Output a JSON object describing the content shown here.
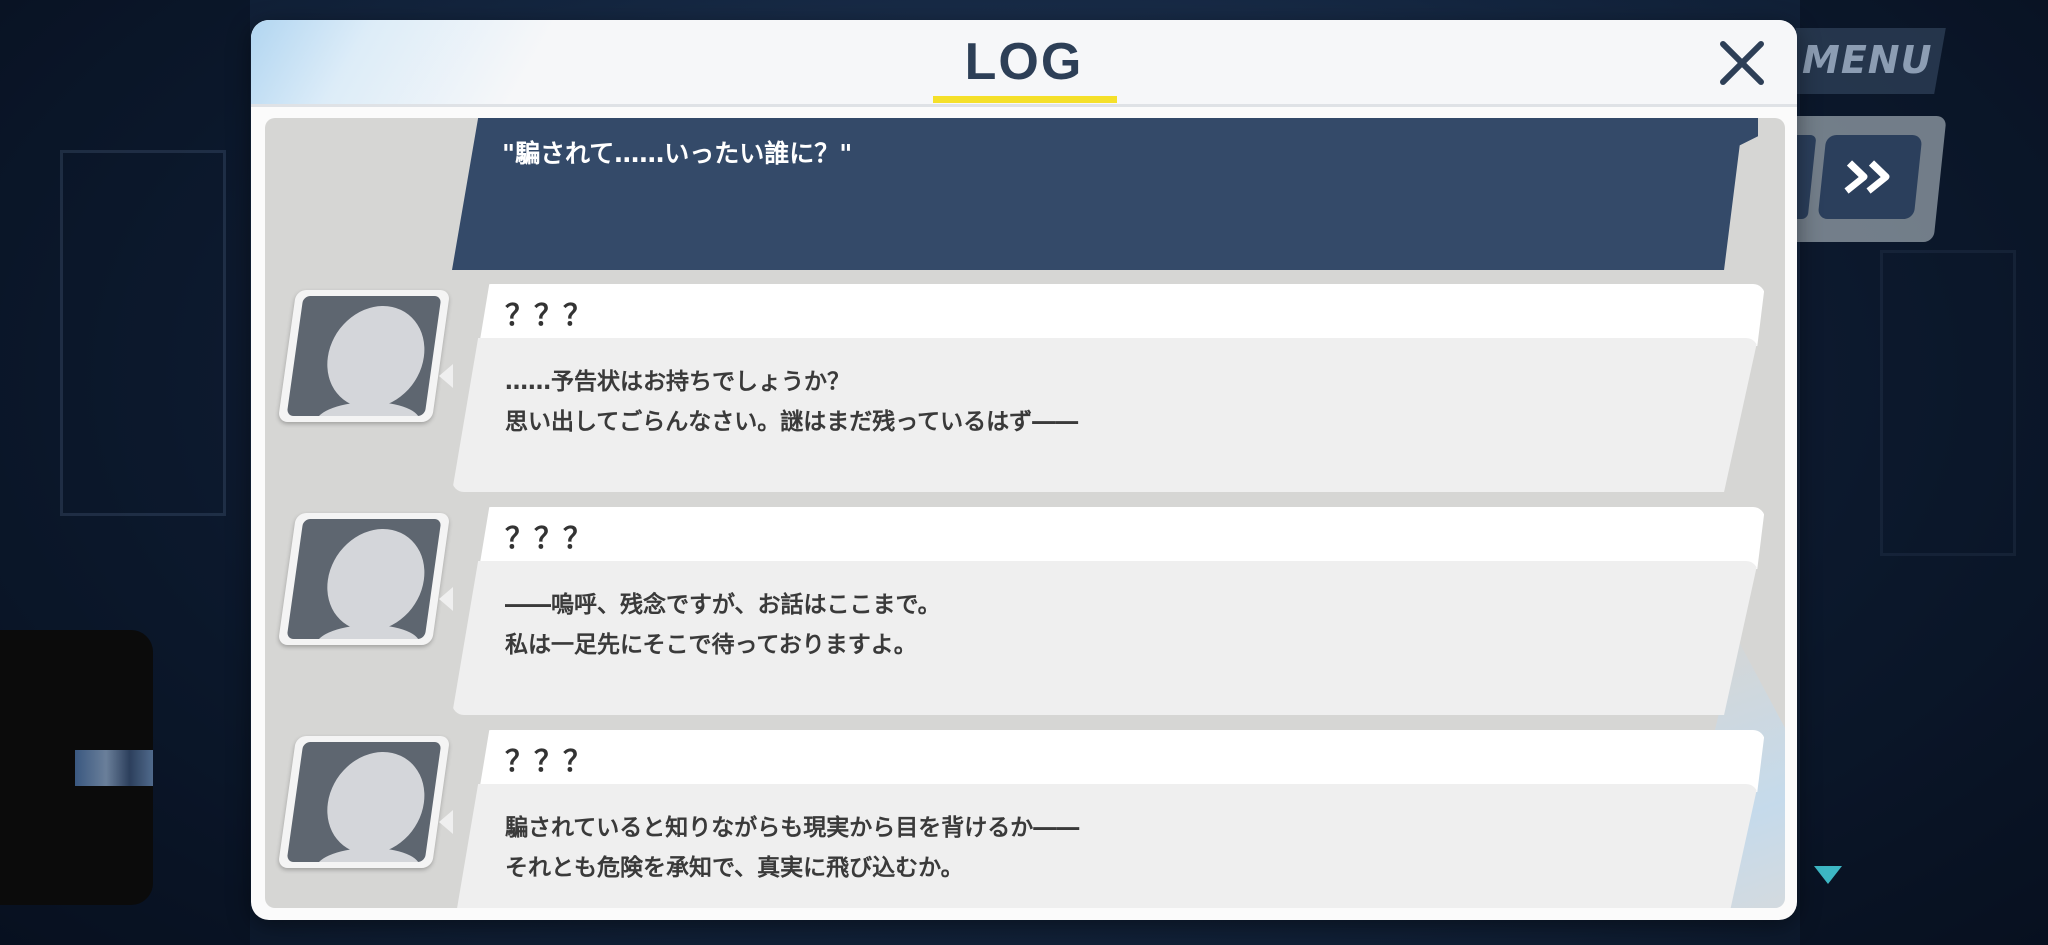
{
  "background": {
    "menu_label": "MENU"
  },
  "log": {
    "title": "LOG",
    "close_icon": "close-icon"
  },
  "player_message": {
    "text": "\"騙されて……いったい誰に？\""
  },
  "entries": [
    {
      "speaker": "？？？",
      "lines": [
        "……予告状はお持ちでしょうか？",
        "思い出してごらんなさい。謎はまだ残っているはず――"
      ]
    },
    {
      "speaker": "？？？",
      "lines": [
        "――嗚呼、残念ですが、お話はここまで。",
        "私は一足先にそこで待っておりますよ。"
      ]
    },
    {
      "speaker": "？？？",
      "lines": [
        "騙されていると知りながらも現実から目を背けるか――",
        "それとも危険を承知で、真実に飛び込むか。"
      ]
    }
  ],
  "colors": {
    "accent_yellow": "#f5e02a",
    "player_bubble": "#344a69",
    "title": "#2d3f57",
    "scroll_arrow": "#3db7c4"
  }
}
